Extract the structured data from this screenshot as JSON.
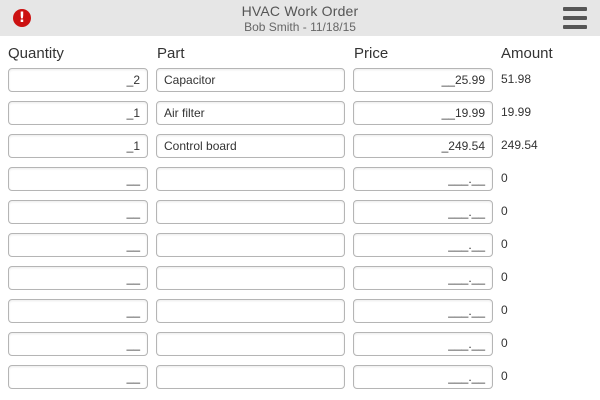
{
  "header": {
    "title": "HVAC Work Order",
    "subtitle": "Bob Smith - 11/18/15",
    "alert_icon": "alert-icon",
    "alert_glyph": "!",
    "menu_icon": "hamburger-menu-icon"
  },
  "columns": {
    "quantity": "Quantity",
    "part": "Part",
    "price": "Price",
    "amount": "Amount"
  },
  "colors": {
    "alert": "#cc1111",
    "header_bg": "#e6e6e6",
    "field_border": "#b5b5b5"
  },
  "rows": [
    {
      "quantity": "_2",
      "part": "Capacitor",
      "price": "__25.99",
      "amount": "51.98"
    },
    {
      "quantity": "_1",
      "part": "Air filter",
      "price": "__19.99",
      "amount": "19.99"
    },
    {
      "quantity": "_1",
      "part": "Control board",
      "price": "_249.54",
      "amount": "249.54"
    },
    {
      "quantity": "__",
      "part": "",
      "price": "___.__",
      "amount": "0"
    },
    {
      "quantity": "__",
      "part": "",
      "price": "___.__",
      "amount": "0"
    },
    {
      "quantity": "__",
      "part": "",
      "price": "___.__",
      "amount": "0"
    },
    {
      "quantity": "__",
      "part": "",
      "price": "___.__",
      "amount": "0"
    },
    {
      "quantity": "__",
      "part": "",
      "price": "___.__",
      "amount": "0"
    },
    {
      "quantity": "__",
      "part": "",
      "price": "___.__",
      "amount": "0"
    },
    {
      "quantity": "__",
      "part": "",
      "price": "___.__",
      "amount": "0"
    }
  ]
}
